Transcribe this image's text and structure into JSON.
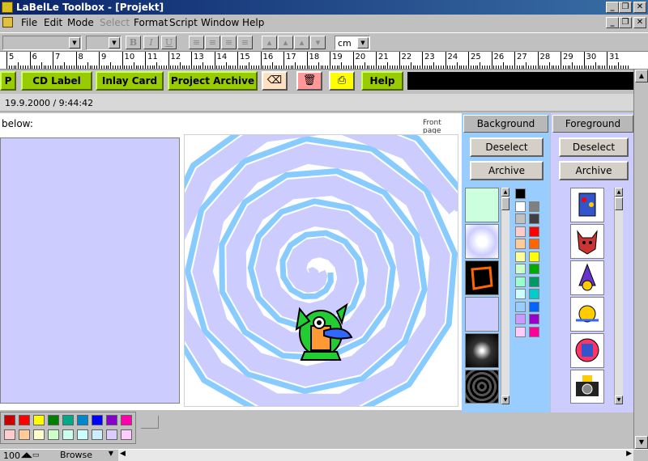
{
  "window": {
    "title": "LaBelLe Toolbox - [Projekt]"
  },
  "menu": [
    "File",
    "Edit",
    "Mode",
    "Select",
    "Format",
    "Script",
    "Window",
    "Help"
  ],
  "format_toolbar": {
    "bold": "B",
    "italic": "I",
    "underline": "U",
    "unit": "cm"
  },
  "ruler": {
    "labels": [
      "5",
      "6",
      "7",
      "8",
      "9",
      "10",
      "11",
      "12",
      "13",
      "14",
      "15",
      "16",
      "17",
      "18",
      "19",
      "20",
      "21",
      "22",
      "23",
      "24",
      "25",
      "26",
      "27",
      "28",
      "29",
      "30",
      "31"
    ]
  },
  "nav": {
    "cut_label": "P",
    "cd_label": "CD Label",
    "inlay_card": "Inlay Card",
    "project_archive": "Project Archive",
    "help": "Help"
  },
  "status": {
    "datetime": "19.9.2000 / 9:44:42"
  },
  "info": {
    "left_text": "below:",
    "page_label": "Front page"
  },
  "background_panel": {
    "title": "Background",
    "deselect": "Deselect",
    "archive": "Archive"
  },
  "foreground_panel": {
    "title": "Foreground",
    "deselect": "Deselect",
    "archive": "Archive"
  },
  "swatches": [
    "#000000",
    "#ffffff",
    "#808080",
    "#c0c0c0",
    "#404040",
    "#ffcccc",
    "#ff0000",
    "#ffcc99",
    "#ff6600",
    "#ffff99",
    "#ffff00",
    "#ccffcc",
    "#00aa00",
    "#99ffcc",
    "#009966",
    "#ccffff",
    "#00cccc",
    "#99ccff",
    "#0066ff",
    "#cc99ff",
    "#9900cc",
    "#ffccff",
    "#ff0099"
  ],
  "palette": {
    "row1": [
      "#cc0000",
      "#ff0000",
      "#ffff00",
      "#008000",
      "#00aa88",
      "#0088cc",
      "#0000ff",
      "#8800cc",
      "#ff00aa"
    ],
    "row2": [
      "#ffcccc",
      "#ffcc99",
      "#ffffcc",
      "#ccffcc",
      "#ccffee",
      "#ccffff",
      "#cceeff",
      "#ddccff",
      "#ffccff"
    ]
  },
  "bottom": {
    "zoom": "100",
    "browse": "Browse"
  }
}
